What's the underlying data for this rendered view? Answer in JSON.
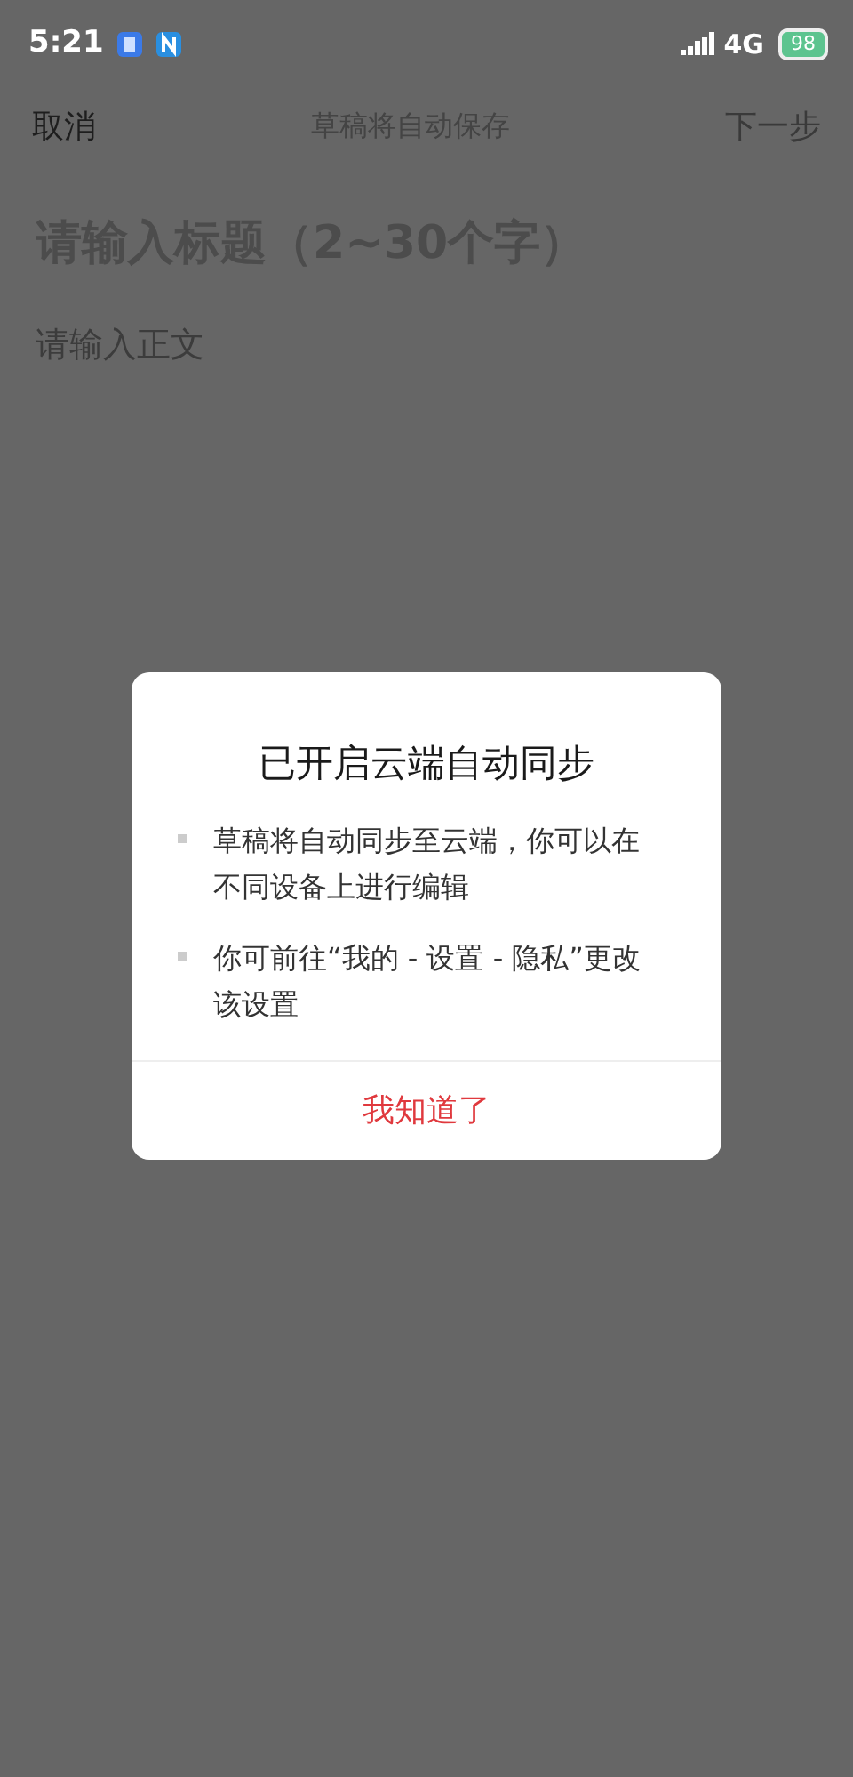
{
  "status_bar": {
    "time": "5:21",
    "network": "4G",
    "battery": "98"
  },
  "header": {
    "cancel": "取消",
    "title": "草稿将自动保存",
    "next": {
      "label": "下一步",
      "disabled": true
    }
  },
  "editor": {
    "title_placeholder": "请输入标题（2~30个字）",
    "body_placeholder": "请输入正文"
  },
  "dialog": {
    "title": "已开启云端自动同步",
    "items": [
      "草稿将自动同步至云端，你可以在不同设备上进行编辑",
      "你可前往“我的 - 设置 - 隐私”更改该设置"
    ],
    "button": "我知道了"
  }
}
